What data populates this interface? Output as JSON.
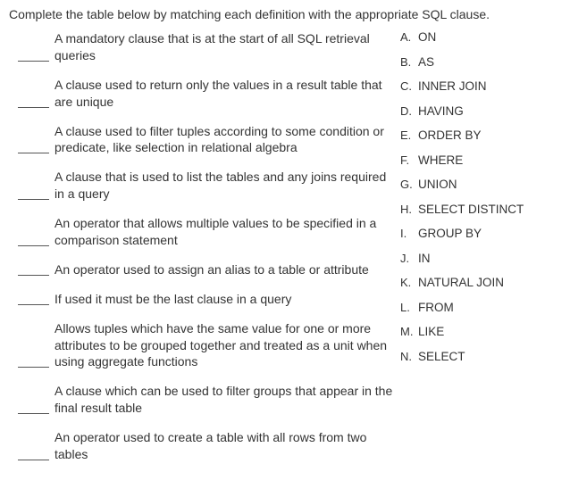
{
  "instruction": "Complete the table below by matching each definition with the appropriate SQL clause.",
  "definitions": [
    {
      "text": "A mandatory clause that is at the start of all SQL retrieval queries"
    },
    {
      "text": "A clause used to return only the values in a result table that are unique"
    },
    {
      "text": "A clause used to filter tuples according to some condition or predicate, like selection in relational algebra"
    },
    {
      "text": "A clause that is used to list the tables and any joins required in a query"
    },
    {
      "text": "An operator that allows multiple values to be specified in a comparison statement"
    },
    {
      "text": "An operator used to assign an alias to a table or attribute"
    },
    {
      "text": "If used it must be the last clause in a query"
    },
    {
      "text": "Allows tuples which have the same value for one or more attributes to be grouped together and treated as a unit when using aggregate functions"
    },
    {
      "text": "A clause which can be used to filter groups that appear in the final result table"
    },
    {
      "text": "An operator used to create a table with all rows from two tables"
    }
  ],
  "choices": [
    {
      "letter": "A.",
      "text": "ON"
    },
    {
      "letter": "B.",
      "text": "AS"
    },
    {
      "letter": "C.",
      "text": "INNER JOIN"
    },
    {
      "letter": "D.",
      "text": "HAVING"
    },
    {
      "letter": "E.",
      "text": "ORDER BY"
    },
    {
      "letter": "F.",
      "text": "WHERE"
    },
    {
      "letter": "G.",
      "text": "UNION"
    },
    {
      "letter": "H.",
      "text": "SELECT DISTINCT"
    },
    {
      "letter": "I.",
      "text": "GROUP BY"
    },
    {
      "letter": "J.",
      "text": "IN"
    },
    {
      "letter": "K.",
      "text": "NATURAL JOIN"
    },
    {
      "letter": "L.",
      "text": "FROM"
    },
    {
      "letter": "M.",
      "text": "LIKE"
    },
    {
      "letter": "N.",
      "text": "SELECT"
    }
  ]
}
